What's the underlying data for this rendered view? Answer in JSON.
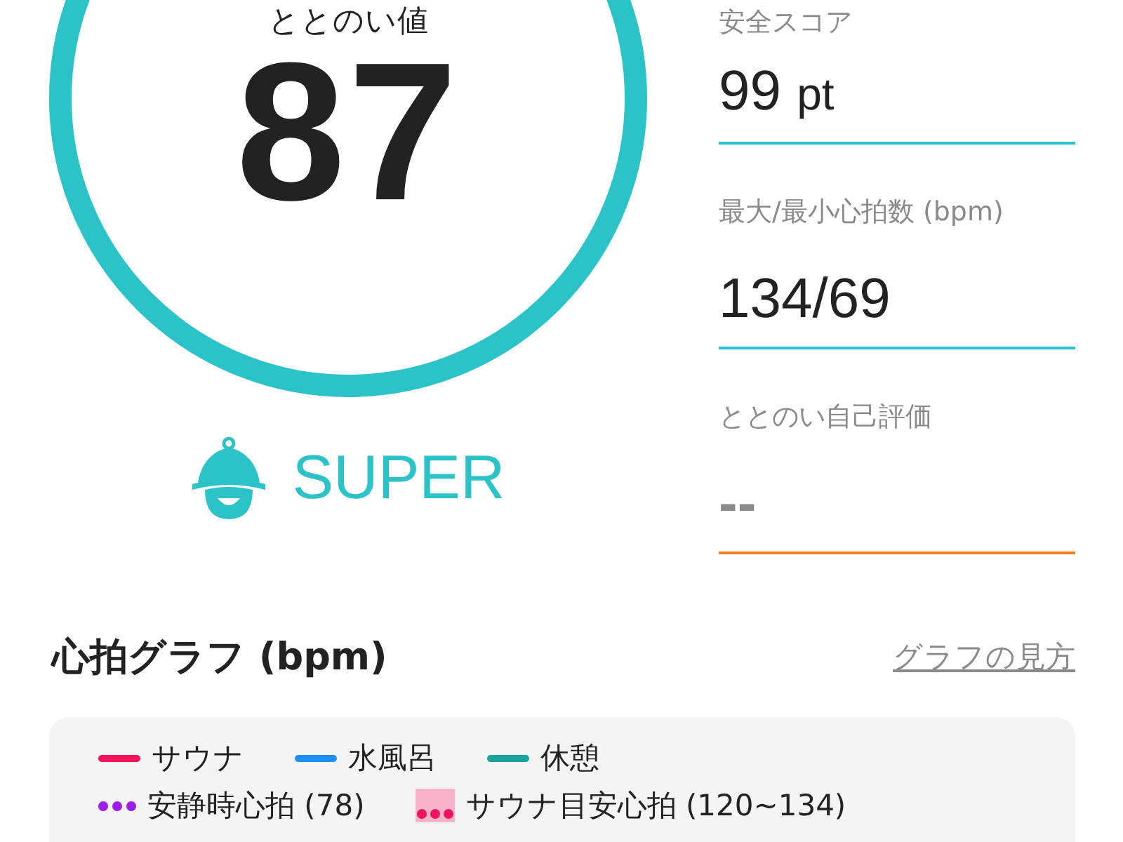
{
  "score": {
    "label": "ととのい値",
    "value": "87"
  },
  "rank": {
    "label": "SUPER"
  },
  "stats": [
    {
      "label": "安全スコア",
      "value": "99",
      "unit": "pt",
      "color": "#2bc2c8"
    },
    {
      "label": "最大/最小心拍数 (bpm)",
      "value": "134/69",
      "color": "#2bc2c8"
    },
    {
      "label": "ととのい自己評価",
      "value": "--",
      "color": "#f57c1f",
      "kind": "empty"
    }
  ],
  "graph": {
    "title": "心拍グラフ (bpm)",
    "help_link": "グラフの見方",
    "legend": [
      {
        "kind": "line",
        "label": "サウナ",
        "color": "#f0145a"
      },
      {
        "kind": "line",
        "label": "水風呂",
        "color": "#1e8ff5"
      },
      {
        "kind": "line",
        "label": "休憩",
        "color": "#1aa39a"
      },
      {
        "kind": "dots",
        "label": "安静時心拍 (78)",
        "color": "#9b1de6"
      },
      {
        "kind": "band",
        "label": "サウナ目安心拍 (120~134)",
        "color": "#f0145a"
      }
    ]
  }
}
